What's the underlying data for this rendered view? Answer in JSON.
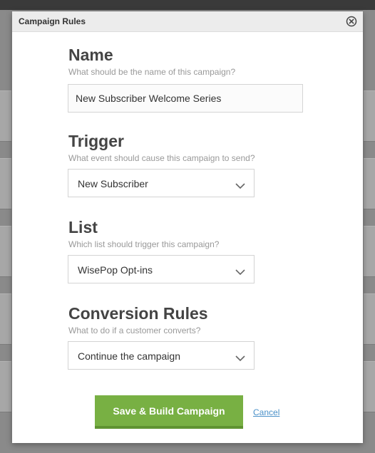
{
  "modal": {
    "title": "Campaign Rules",
    "close_icon": "close-circle-icon"
  },
  "name_section": {
    "title": "Name",
    "help": "What should be the name of this campaign?",
    "value": "New Subscriber Welcome Series"
  },
  "trigger_section": {
    "title": "Trigger",
    "help": "What event should cause this campaign to send?",
    "selected": "New Subscriber",
    "icon": "chevron-down-icon"
  },
  "list_section": {
    "title": "List",
    "help": "Which list should trigger this campaign?",
    "selected": "WisePop Opt-ins",
    "icon": "chevron-down-icon"
  },
  "conversion_section": {
    "title": "Conversion Rules",
    "help": "What to do if a customer converts?",
    "selected": "Continue the campaign",
    "icon": "chevron-down-icon"
  },
  "actions": {
    "primary_label": "Save & Build Campaign",
    "cancel_label": "Cancel"
  },
  "colors": {
    "primary": "#78b043",
    "link": "#4a90c8",
    "overlay": "#8a8a8a"
  }
}
